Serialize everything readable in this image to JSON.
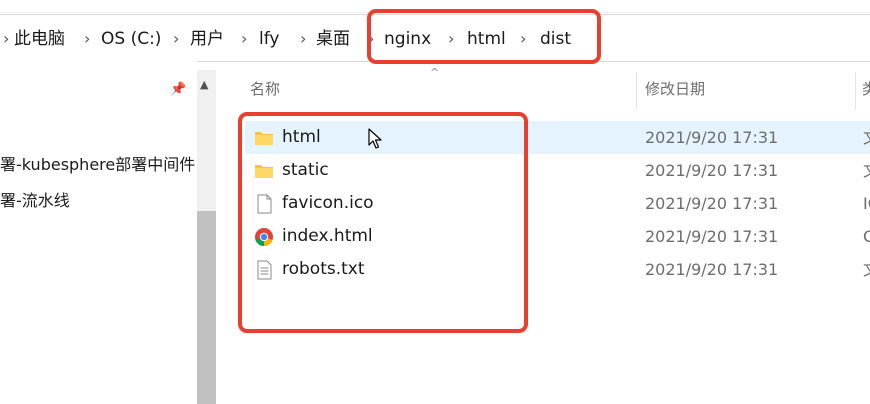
{
  "breadcrumb": {
    "items": [
      "此电脑",
      "OS (C:)",
      "用户",
      "lfy",
      "桌面",
      "nginx",
      "html",
      "dist"
    ],
    "separator": "›"
  },
  "navigation": {
    "items": [
      "署-kubesphere部署中间件",
      "署-流水线"
    ]
  },
  "columns": {
    "name": "名称",
    "modified": "修改日期",
    "type": "类"
  },
  "files": [
    {
      "name": "html",
      "modified": "2021/9/20 17:31",
      "type": "文",
      "icon": "folder-icon"
    },
    {
      "name": "static",
      "modified": "2021/9/20 17:31",
      "type": "文",
      "icon": "folder-icon"
    },
    {
      "name": "favicon.ico",
      "modified": "2021/9/20 17:31",
      "type": "IC",
      "icon": "file-icon"
    },
    {
      "name": "index.html",
      "modified": "2021/9/20 17:31",
      "type": "C",
      "icon": "chrome-icon"
    },
    {
      "name": "robots.txt",
      "modified": "2021/9/20 17:31",
      "type": "文",
      "icon": "text-file-icon"
    }
  ],
  "colors": {
    "annotation": "#e8402e",
    "hover_row": "#e5f3ff",
    "folder": "#f5c542"
  }
}
